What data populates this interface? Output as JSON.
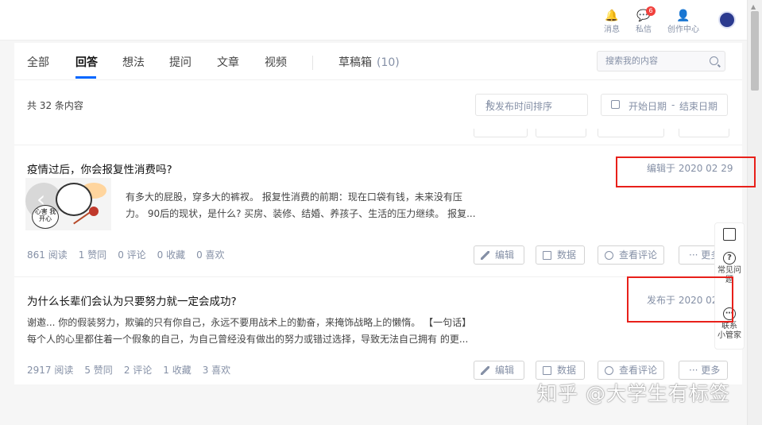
{
  "topbar": {
    "messages_label": "消息",
    "dm_label": "私信",
    "dm_badge": "6",
    "creator_label": "创作中心"
  },
  "tabs": [
    {
      "label": "全部"
    },
    {
      "label": "回答",
      "active": true
    },
    {
      "label": "想法"
    },
    {
      "label": "提问"
    },
    {
      "label": "文章"
    },
    {
      "label": "视频"
    }
  ],
  "drafts": {
    "label": "草稿箱",
    "count": "(10)"
  },
  "search": {
    "placeholder": "搜索我的内容"
  },
  "list_header": {
    "total": "共 32 条内容",
    "sort_label": "按发布时间排序",
    "date_start": "开始日期",
    "date_sep": "-",
    "date_end": "结束日期"
  },
  "items": [
    {
      "title": "疫情过后，你会报复性消费吗?",
      "meta": "编辑于 2020 02 29",
      "thumb_text": "心害 我开心",
      "excerpt_line1": "有多大的屁股，穿多大的裤衩。 报复性消费的前期：现在口袋有钱，未来没有压",
      "excerpt_line2": "力。 90后的现状，是什么? 买房、装修、结婚、养孩子、生活的压力继续。 报复...",
      "stats": {
        "reads": "861 阅读",
        "likes": "1 赞同",
        "comments": "0 评论",
        "collects": "0 收藏",
        "favs": "0 喜欢"
      },
      "actions": {
        "edit": "编辑",
        "data": "数据",
        "view_comments": "查看评论",
        "more": "··· 更多"
      }
    },
    {
      "title": "为什么长辈们会认为只要努力就一定会成功?",
      "meta": "发布于 2020 02",
      "excerpt_line1": "谢邀... 你的假装努力，欺骗的只有你自己，永远不要用战术上的勤奋，来掩饰战略上的懒惰。 【一句话】",
      "excerpt_line2": "每个人的心里都住着一个假象的自己，为自己曾经没有做出的努力或错过选择，导致无法自己拥有 的更...",
      "stats": {
        "reads": "2917 阅读",
        "likes": "5 赞同",
        "comments": "2 评论",
        "collects": "1 收藏",
        "favs": "3 喜欢"
      },
      "actions": {
        "edit": "编辑",
        "data": "数据",
        "view_comments": "查看评论",
        "more": "··· 更多"
      }
    }
  ],
  "float_bar": {
    "faq_label": "常见问题",
    "contact_label_1": "联系",
    "contact_label_2": "小管家"
  },
  "watermark": "知乎 @大学生有标签",
  "colors": {
    "accent": "#0066ff",
    "highlight_box": "#e8201a",
    "muted": "#8590a6"
  }
}
